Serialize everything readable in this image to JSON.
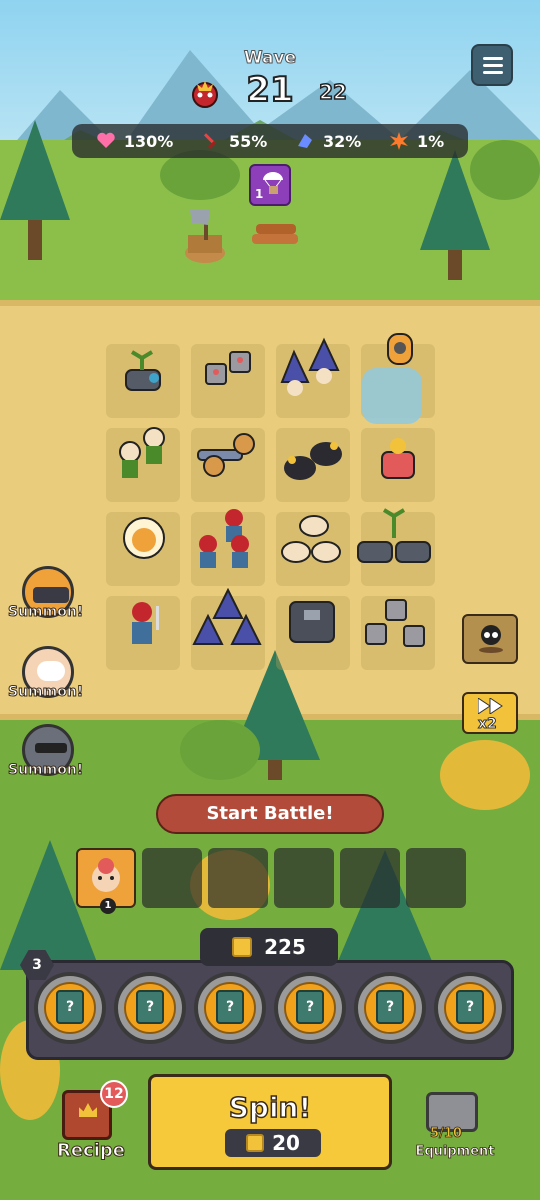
{
  "hud": {
    "wave_label": "Wave",
    "wave_current": "21",
    "wave_next": "22",
    "menu_icon": "hamburger-menu-icon"
  },
  "stats": [
    {
      "icon": "heart-icon",
      "value": "130%",
      "color": "#ff6fa8"
    },
    {
      "icon": "sword-icon",
      "value": "55%",
      "color": "#e84444"
    },
    {
      "icon": "magic-icon",
      "value": "32%",
      "color": "#6a8cff"
    },
    {
      "icon": "explosion-icon",
      "value": "1%",
      "color": "#ff7a2a"
    }
  ],
  "supply_drop": {
    "icon": "parachute-crate-icon",
    "count": "1"
  },
  "summons": [
    {
      "label": "Summon!",
      "icon": "helmet-warrior-icon"
    },
    {
      "label": "Summon!",
      "icon": "cat-hero-icon"
    },
    {
      "label": "Summon!",
      "icon": "dark-knight-icon"
    }
  ],
  "side_buttons": {
    "skull": "skull-icon",
    "speed_label": "x2"
  },
  "start_battle": "Start Battle!",
  "hero_slot": {
    "level": "1"
  },
  "gold": "225",
  "card_level": "3",
  "cards": [
    "?",
    "?",
    "?",
    "?",
    "?",
    "?"
  ],
  "spin": {
    "label": "Spin!",
    "cost": "20"
  },
  "recipe": {
    "label": "Recipe",
    "badge": "12"
  },
  "equipment": {
    "label": "Equipment",
    "ratio": "5/10"
  },
  "colors": {
    "gold": "#f2c33a",
    "start_btn": "#b24b3a",
    "panel": "#4a4656"
  }
}
